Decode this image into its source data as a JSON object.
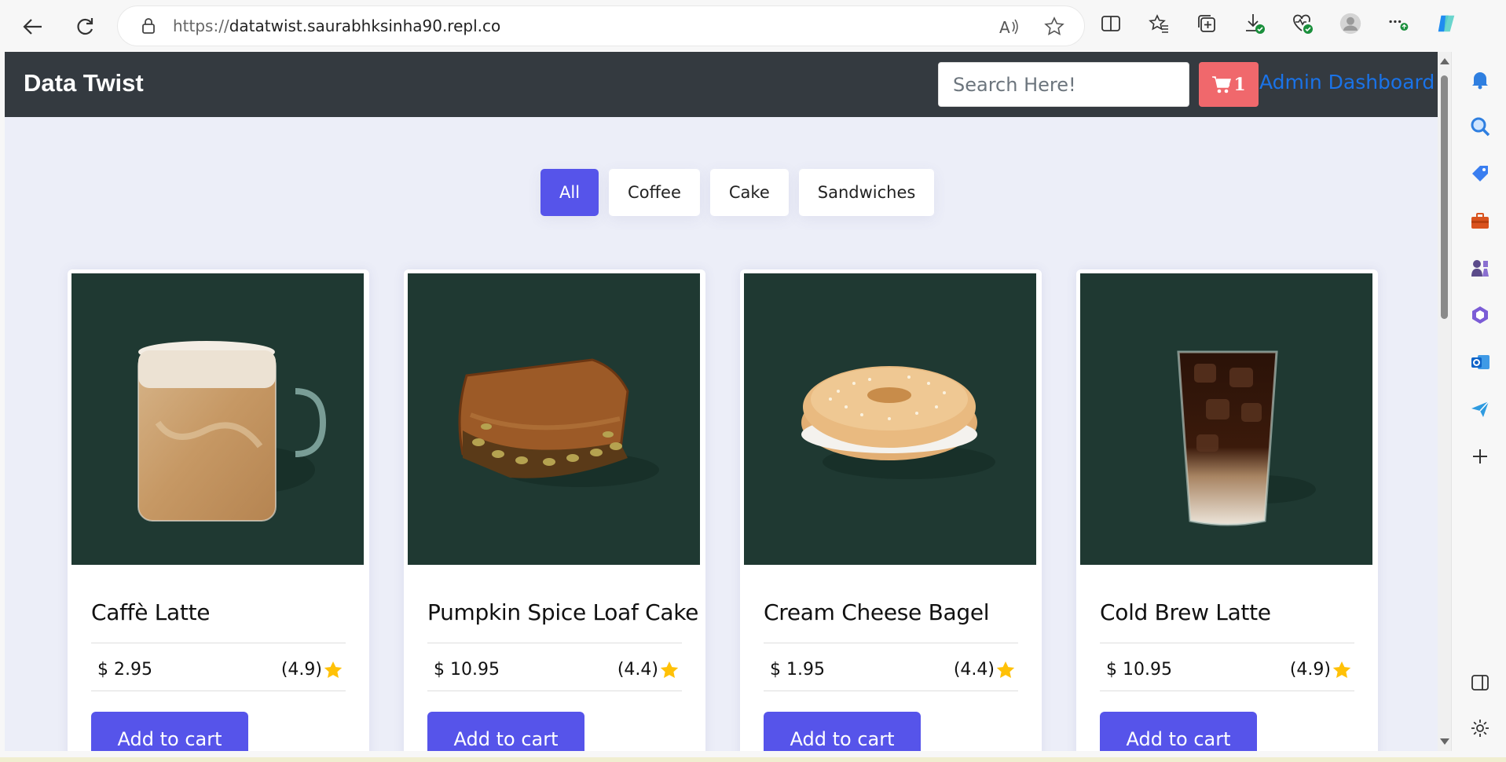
{
  "browser": {
    "url_prefix": "https://",
    "url_host": "datatwist.saurabhksinha90.repl.co"
  },
  "header": {
    "brand": "Data Twist",
    "search_placeholder": "Search Here!",
    "cart_count": "1",
    "admin_link": "Admin Dashboard"
  },
  "filters": [
    {
      "label": "All",
      "active": true
    },
    {
      "label": "Coffee",
      "active": false
    },
    {
      "label": "Cake",
      "active": false
    },
    {
      "label": "Sandwiches",
      "active": false
    }
  ],
  "products": [
    {
      "name": "Caffè Latte",
      "price": "$ 2.95",
      "rating": "(4.9)",
      "button": "Add to cart",
      "image": "latte-mug"
    },
    {
      "name": "Pumpkin Spice Loaf Cake",
      "price": "$ 10.95",
      "rating": "(4.4)",
      "button": "Add to cart",
      "image": "loaf-slice"
    },
    {
      "name": "Cream Cheese Bagel",
      "price": "$ 1.95",
      "rating": "(4.4)",
      "button": "Add to cart",
      "image": "bagel"
    },
    {
      "name": "Cold Brew Latte",
      "price": "$ 10.95",
      "rating": "(4.9)",
      "button": "Add to cart",
      "image": "iced-glass"
    }
  ],
  "colors": {
    "accent": "#5654ea",
    "header_bg": "#343a40",
    "cart_bg": "#f0686c",
    "image_bg": "#1f3932",
    "star": "#ffc107"
  }
}
